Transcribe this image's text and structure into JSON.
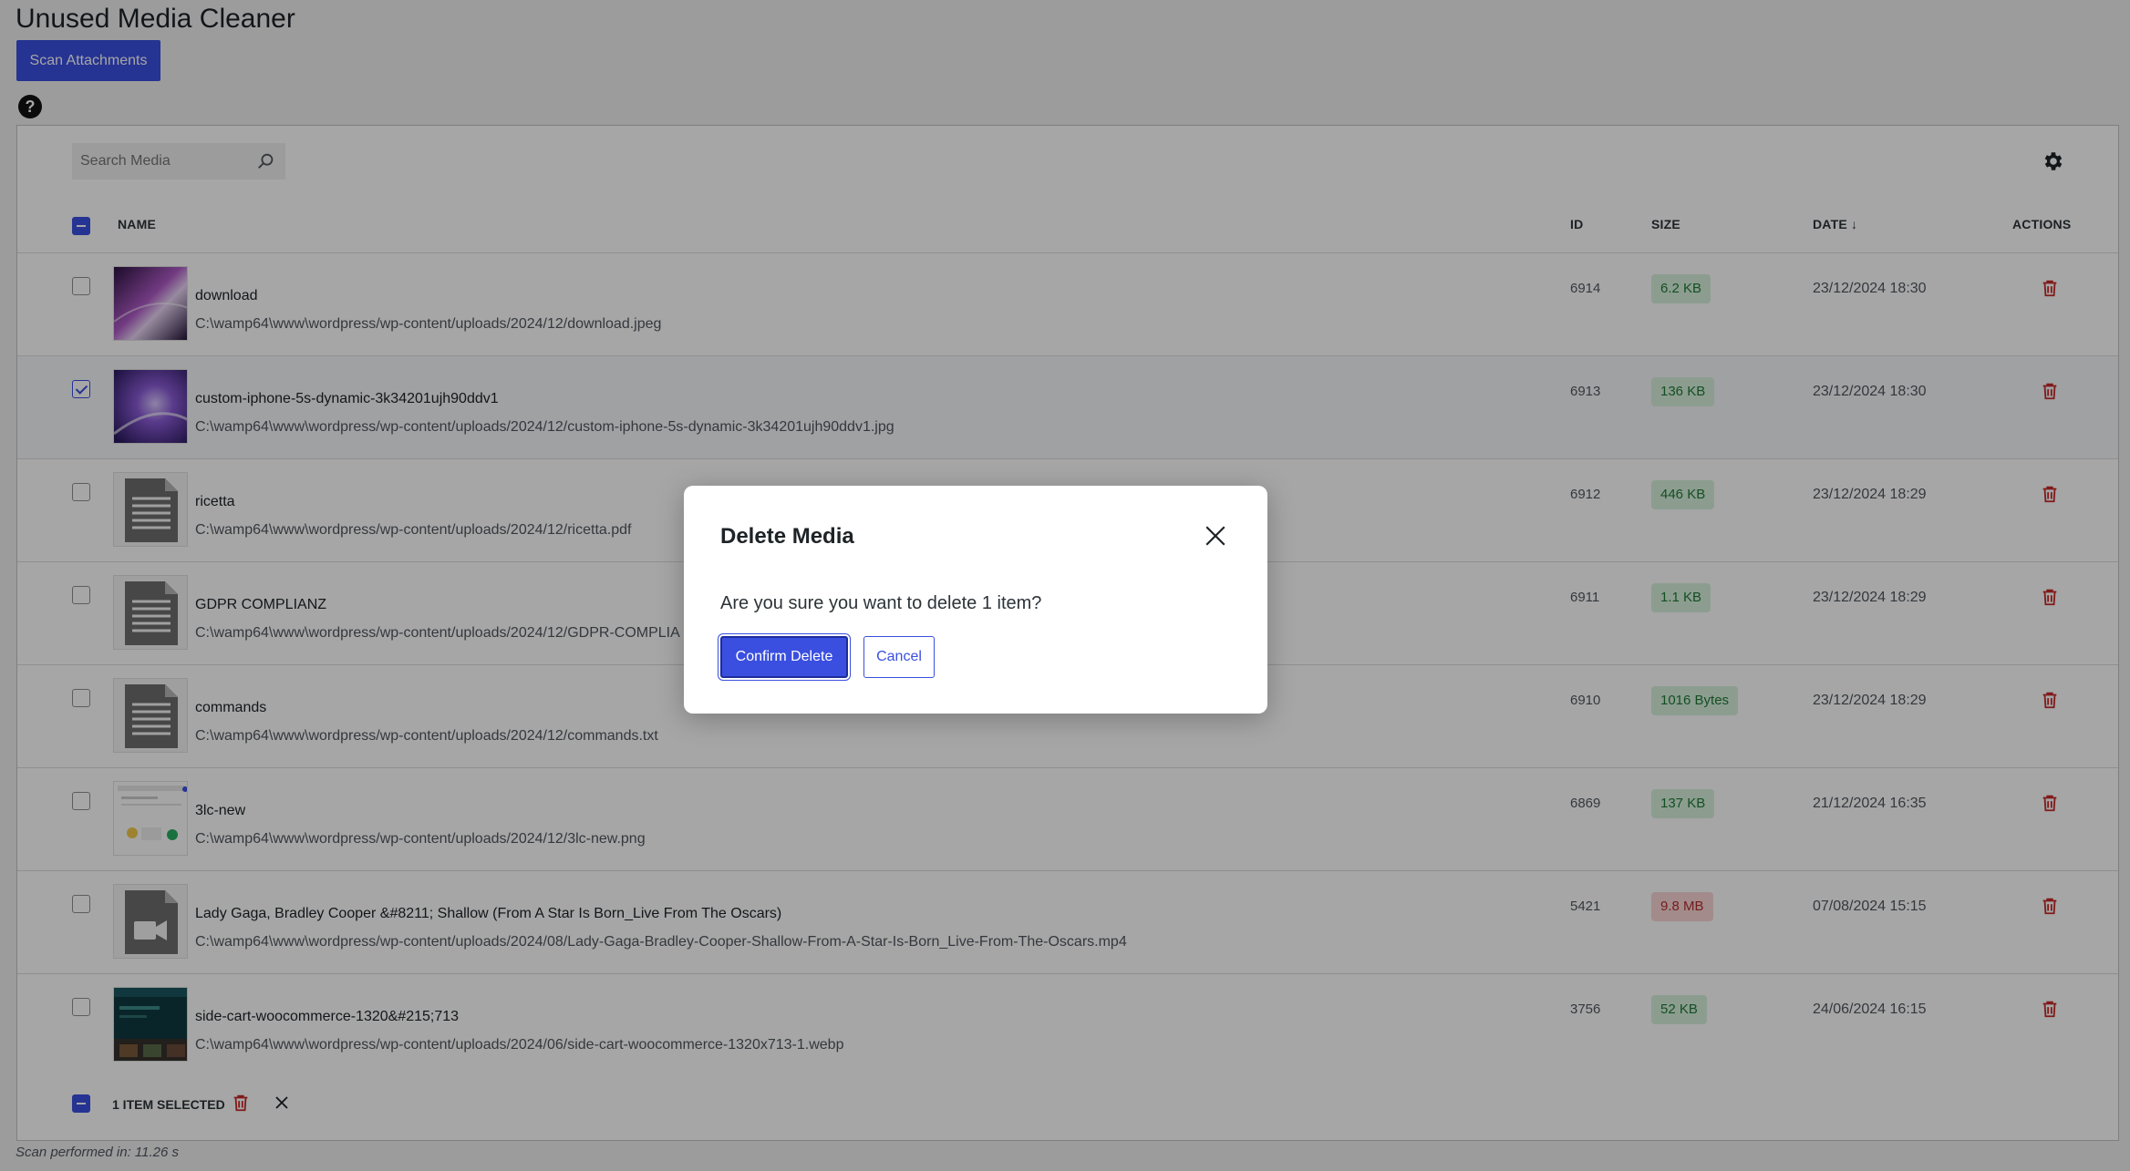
{
  "page": {
    "title": "Unused Media Cleaner",
    "scan_button": "Scan Attachments",
    "help_glyph": "?",
    "scan_time": "Scan performed in: 11.26 s"
  },
  "toolbar": {
    "search_placeholder": "Search Media",
    "search_icon": "search-icon",
    "settings_icon": "gear-icon"
  },
  "table": {
    "headers": {
      "name": "NAME",
      "id": "ID",
      "size": "SIZE",
      "date": "DATE ↓",
      "actions": "ACTIONS"
    },
    "rows": [
      {
        "name": "download",
        "path": "C:\\wamp64\\www\\wordpress/wp-content/uploads/2024/12/download.jpeg",
        "id": "6914",
        "size": "6.2 KB",
        "date": "23/12/2024 18:30",
        "checked": false,
        "thumb": "image-galaxy",
        "size_level": "ok"
      },
      {
        "name": "custom-iphone-5s-dynamic-3k34201ujh90ddv1",
        "path": "C:\\wamp64\\www\\wordpress/wp-content/uploads/2024/12/custom-iphone-5s-dynamic-3k34201ujh90ddv1.jpg",
        "id": "6913",
        "size": "136 KB",
        "date": "23/12/2024 18:30",
        "checked": true,
        "thumb": "image-purple",
        "size_level": "ok"
      },
      {
        "name": "ricetta",
        "path": "C:\\wamp64\\www\\wordpress/wp-content/uploads/2024/12/ricetta.pdf",
        "id": "6912",
        "size": "446 KB",
        "date": "23/12/2024 18:29",
        "checked": false,
        "thumb": "document-icon",
        "size_level": "ok"
      },
      {
        "name": "GDPR COMPLIANZ",
        "path": "C:\\wamp64\\www\\wordpress/wp-content/uploads/2024/12/GDPR-COMPLIA",
        "id": "6911",
        "size": "1.1 KB",
        "date": "23/12/2024 18:29",
        "checked": false,
        "thumb": "document-icon",
        "size_level": "ok"
      },
      {
        "name": "commands",
        "path": "C:\\wamp64\\www\\wordpress/wp-content/uploads/2024/12/commands.txt",
        "id": "6910",
        "size": "1016 Bytes",
        "date": "23/12/2024 18:29",
        "checked": false,
        "thumb": "document-icon",
        "size_level": "ok"
      },
      {
        "name": "3lc-new",
        "path": "C:\\wamp64\\www\\wordpress/wp-content/uploads/2024/12/3lc-new.png",
        "id": "6869",
        "size": "137 KB",
        "date": "21/12/2024 16:35",
        "checked": false,
        "thumb": "image-screenshot",
        "size_level": "ok"
      },
      {
        "name": "Lady Gaga, Bradley Cooper &#8211; Shallow (From A Star Is Born_Live From The Oscars)",
        "path": "C:\\wamp64\\www\\wordpress/wp-content/uploads/2024/08/Lady-Gaga-Bradley-Cooper-Shallow-From-A-Star-Is-Born_Live-From-The-Oscars.mp4",
        "id": "5421",
        "size": "9.8 MB",
        "date": "07/08/2024 15:15",
        "checked": false,
        "thumb": "video-file-icon",
        "size_level": "large"
      },
      {
        "name": "side-cart-woocommerce-1320&#215;713",
        "path": "C:\\wamp64\\www\\wordpress/wp-content/uploads/2024/06/side-cart-woocommerce-1320x713-1.webp",
        "id": "3756",
        "size": "52 KB",
        "date": "24/06/2024 16:15",
        "checked": false,
        "thumb": "image-dark-screenshot",
        "size_level": "ok"
      }
    ]
  },
  "footer": {
    "selected_label": "1 ITEM SELECTED"
  },
  "modal": {
    "title": "Delete Media",
    "message": "Are you sure you want to delete 1 item?",
    "confirm": "Confirm Delete",
    "cancel": "Cancel"
  },
  "colors": {
    "accent": "#3a4fe0",
    "danger": "#b32d2e",
    "ok_badge_bg": "#d8f1dd",
    "large_badge_bg": "#fbd6d6"
  }
}
